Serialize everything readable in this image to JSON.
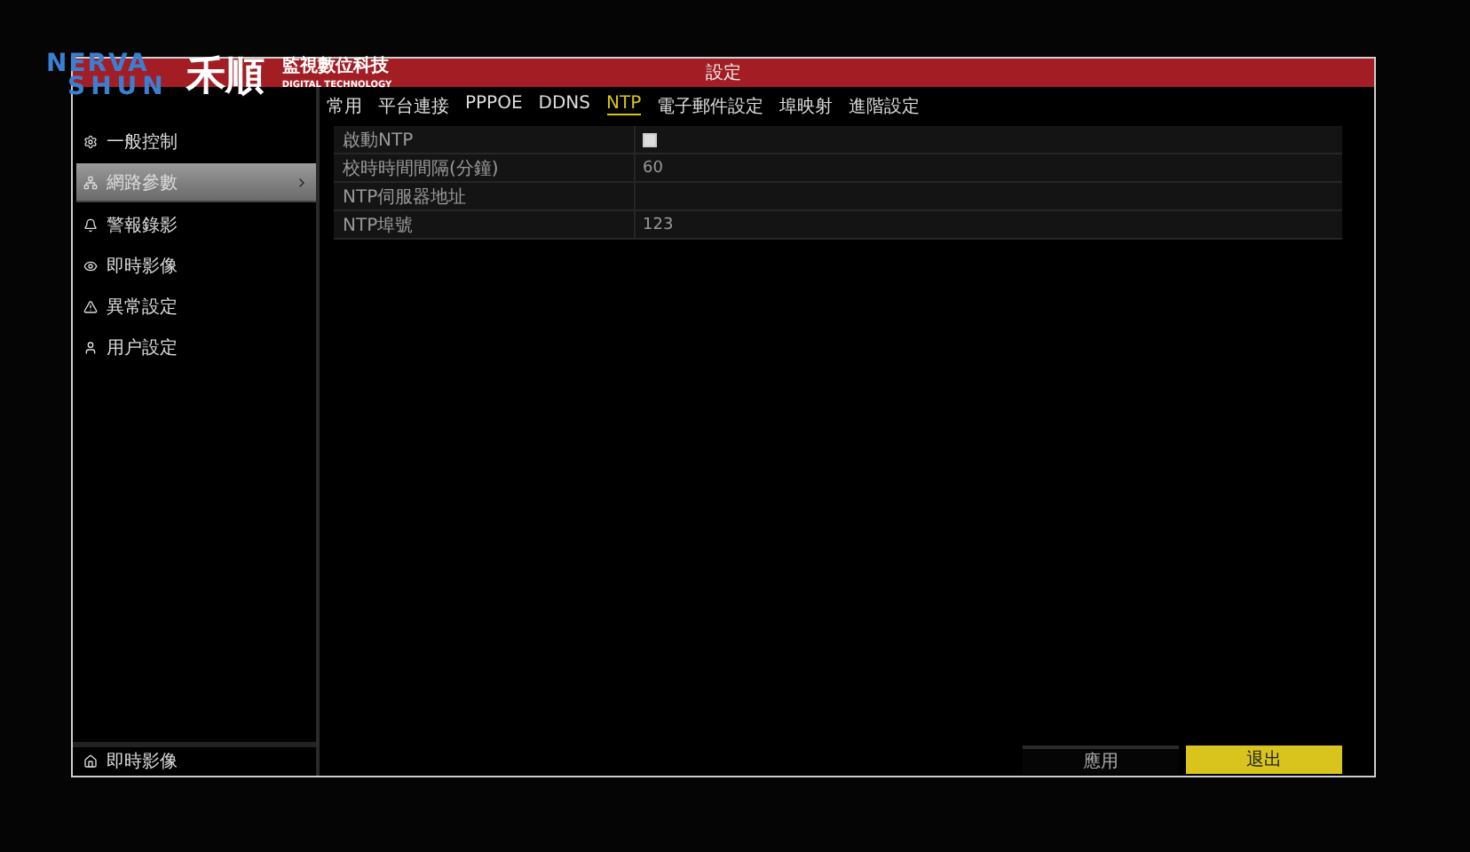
{
  "logo": {
    "top": "NERVA",
    "bottom": "SHUN",
    "mark": "禾順",
    "name": "監視數位科技",
    "tagline": "DIGITAL TECHNOLOGY"
  },
  "window": {
    "title": "設定"
  },
  "sidebar": {
    "items": [
      {
        "label": "一般控制",
        "selected": false
      },
      {
        "label": "網路參數",
        "selected": true
      },
      {
        "label": "警報錄影",
        "selected": false
      },
      {
        "label": "即時影像",
        "selected": false
      },
      {
        "label": "異常設定",
        "selected": false
      },
      {
        "label": "用户設定",
        "selected": false
      }
    ],
    "footer": "即時影像"
  },
  "tabs": [
    {
      "label": "常用",
      "selected": false
    },
    {
      "label": "平台連接",
      "selected": false
    },
    {
      "label": "PPPOE",
      "selected": false
    },
    {
      "label": "DDNS",
      "selected": false
    },
    {
      "label": "NTP",
      "selected": true
    },
    {
      "label": "電子郵件設定",
      "selected": false
    },
    {
      "label": "埠映射",
      "selected": false
    },
    {
      "label": "進階設定",
      "selected": false
    }
  ],
  "settings": [
    {
      "kind": "checkbox",
      "label": "啟動NTP",
      "checked": false
    },
    {
      "kind": "value",
      "label": "校時時間間隔(分鐘)",
      "value": "60"
    },
    {
      "kind": "value",
      "label": "NTP伺服器地址"
    },
    {
      "kind": "value",
      "label": "NTP埠號",
      "value": "123"
    }
  ],
  "buttons": [
    {
      "label": "應用",
      "kind": "secondary"
    },
    {
      "label": "退出",
      "kind": "primary"
    }
  ]
}
